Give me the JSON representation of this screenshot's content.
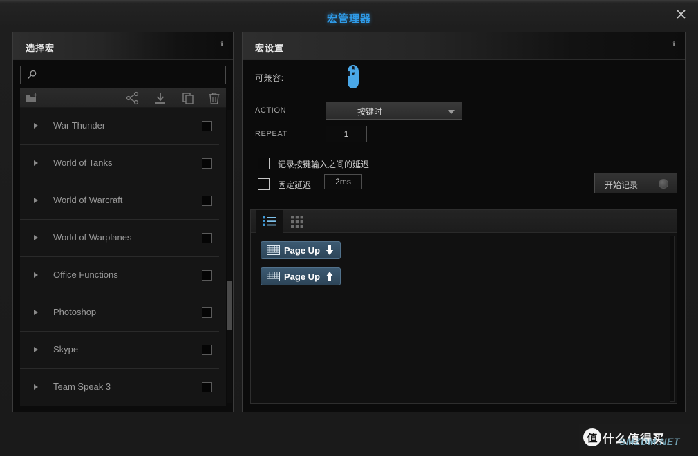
{
  "window": {
    "title": "宏管理器",
    "close_label": "✕"
  },
  "left_panel": {
    "header": "选择宏",
    "info_icon": "i",
    "search": {
      "value": "",
      "placeholder": ""
    },
    "toolbar": [
      {
        "name": "new-folder-icon",
        "label": "新建文件夹"
      },
      {
        "name": "share-icon",
        "label": "分享"
      },
      {
        "name": "import-icon",
        "label": "导入"
      },
      {
        "name": "duplicate-icon",
        "label": "复制"
      },
      {
        "name": "delete-icon",
        "label": "删除"
      }
    ],
    "items": [
      {
        "label": "War Thunder"
      },
      {
        "label": "World of Tanks"
      },
      {
        "label": "World of Warcraft"
      },
      {
        "label": "World of Warplanes"
      },
      {
        "label": "Office Functions"
      },
      {
        "label": "Photoshop"
      },
      {
        "label": "Skype"
      },
      {
        "label": "Team Speak 3"
      }
    ],
    "scroll": {
      "thumb_top_pct": 58,
      "thumb_height_pct": 17
    }
  },
  "right_panel": {
    "header": "宏设置",
    "info_icon": "i",
    "compatible_label": "可兼容:",
    "device_icon": "mouse-icon",
    "action_label": "ACTION",
    "action_value": "按键时",
    "repeat_label": "REPEAT",
    "repeat_value": "1",
    "checkbox_record_delay": {
      "label": "记录按键输入之间的延迟",
      "checked": false
    },
    "checkbox_fixed_delay": {
      "label": "固定延迟",
      "checked": false
    },
    "fixed_delay_value": "2ms",
    "record_button": {
      "label": "开始记录",
      "indicator": "record-dot"
    },
    "view_tabs": [
      {
        "name": "list-view",
        "icon": "list-icon",
        "active": true
      },
      {
        "name": "grid-view",
        "icon": "grid-icon",
        "active": false
      }
    ],
    "sequence": [
      {
        "key": "Page Up",
        "direction": "down",
        "arrow": "↓"
      },
      {
        "key": "Page Up",
        "direction": "up",
        "arrow": "↑"
      }
    ]
  },
  "watermark": {
    "badge": "值",
    "text": "什么值得买",
    "sub": "SMZDM.NET"
  },
  "colors": {
    "accent_blue": "#2f9be8",
    "chip_blue": "#3c5a72",
    "device_blue": "#4aa8e8"
  }
}
